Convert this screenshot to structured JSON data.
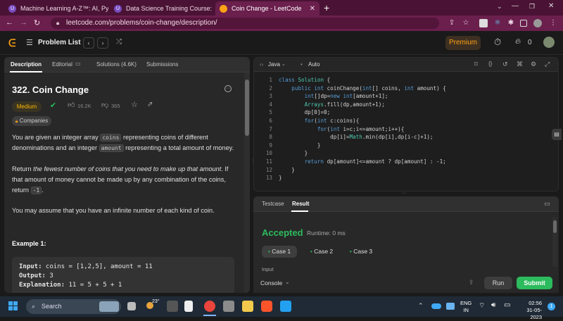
{
  "browser": {
    "tabs": [
      {
        "title": "Machine Learning A-Z™: AI, Pyth",
        "active": false
      },
      {
        "title": "Data Science Training Course: Da",
        "active": false
      },
      {
        "title": "Coin Change - LeetCode",
        "active": true
      }
    ],
    "url": "leetcode.com/problems/coin-change/description/"
  },
  "nav": {
    "problem_list": "Problem List",
    "premium": "Premium",
    "streak_count": "0"
  },
  "left": {
    "tabs": [
      "Description",
      "Editorial",
      "Solutions (4.6K)",
      "Submissions"
    ],
    "title": "322. Coin Change",
    "difficulty": "Medium",
    "likes": "16.2K",
    "dislikes": "365",
    "companies": "Companies",
    "p1a": "You are given an integer array ",
    "p1code1": "coins",
    "p1b": " representing coins of different denominations and an integer ",
    "p1code2": "amount",
    "p1c": " representing a total amount of money.",
    "p2a": "Return ",
    "p2em": "the fewest number of coins that you need to make up that amount",
    "p2b": ". If that amount of money cannot be made up by any combination of the coins, return ",
    "p2code": "-1",
    "p2c": ".",
    "p3": "You may assume that you have an infinite number of each kind of coin.",
    "example_title": "Example 1:",
    "example_input_label": "Input:",
    "example_input": " coins = [1,2,5], amount = 11",
    "example_output_label": "Output:",
    "example_output": " 3",
    "example_expl_label": "Explanation:",
    "example_expl": " 11 = 5 + 5 + 1"
  },
  "editor": {
    "language": "Java",
    "mode": "Auto",
    "lines": [
      "class Solution {",
      "    public int coinChange(int[] coins, int amount) {",
      "        int[]dp=new int[amount+1];",
      "        Arrays.fill(dp,amount+1);",
      "        dp[0]=0;",
      "        for(int c:coins){",
      "            for(int i=c;i<=amount;i++){",
      "                dp[i]=Math.min(dp[i],dp[i-c]+1);",
      "            }",
      "        }",
      "        return dp[amount]<=amount ? dp[amount] : -1;",
      "    }",
      "}"
    ],
    "line_numbers": [
      "1",
      "2",
      "3",
      "4",
      "5",
      "6",
      "7",
      "8",
      "9",
      "10",
      "11",
      "12",
      "13"
    ]
  },
  "result": {
    "tabs": [
      "Testcase",
      "Result"
    ],
    "status": "Accepted",
    "runtime": "Runtime: 0 ms",
    "cases": [
      "Case 1",
      "Case 2",
      "Case 3"
    ],
    "input_label": "Input"
  },
  "console": {
    "label": "Console",
    "run": "Run",
    "submit": "Submit"
  },
  "taskbar": {
    "search": "Search",
    "weather": "23°",
    "lang_line1": "ENG",
    "lang_line2": "IN",
    "time": "02:56",
    "date": "31-05-2023"
  },
  "colors": {
    "accent_green": "#2cbb5d",
    "medium": "#ffb800",
    "premium": "#ffa116",
    "tabbar": "#4a1335"
  }
}
